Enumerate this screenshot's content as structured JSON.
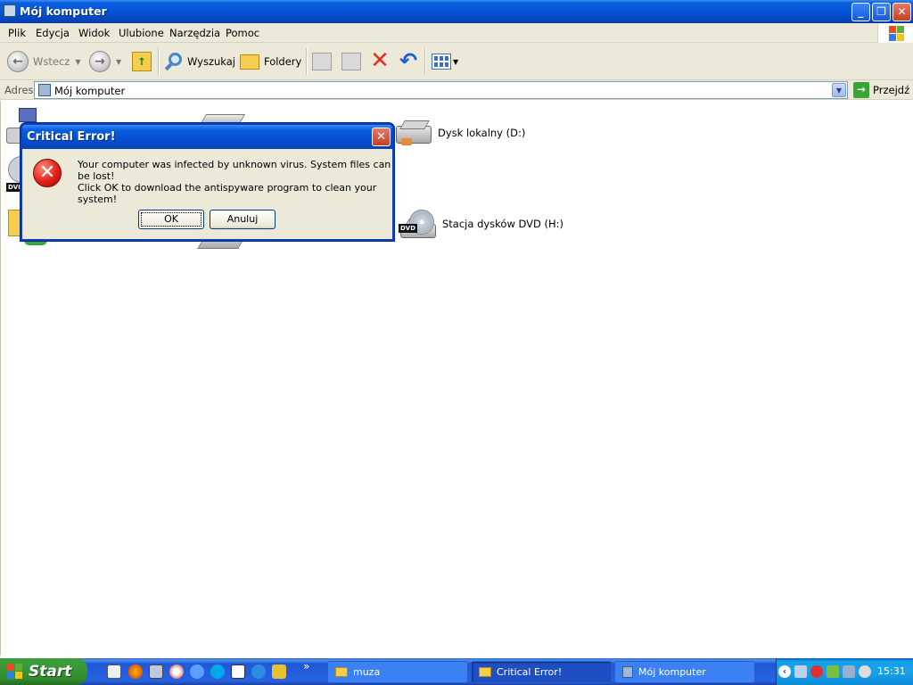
{
  "window": {
    "title": "Mój komputer",
    "buttons": {
      "minimize": "_",
      "maximize": "❐",
      "close": "✕"
    }
  },
  "menu": [
    "Plik",
    "Edycja",
    "Widok",
    "Ulubione",
    "Narzędzia",
    "Pomoc"
  ],
  "toolbar": {
    "back_label": "Wstecz",
    "search_label": "Wyszukaj",
    "folders_label": "Foldery"
  },
  "address": {
    "label": "Adres",
    "value": "Mój komputer",
    "go_label": "Przejdź"
  },
  "drives": [
    {
      "label": "Dysk lokalny (D:)"
    },
    {
      "label": "Stacja dysków DVD (H:)"
    }
  ],
  "dialog": {
    "title": "Critical Error!",
    "message_line1": "Your computer was infected by unknown virus. System files can be lost!",
    "message_line2": "Click OK to download the antispyware program to clean your system!",
    "ok_label": "OK",
    "cancel_label": "Anuluj"
  },
  "taskbar": {
    "start_label": "Start",
    "tasks": [
      {
        "label": "muza"
      },
      {
        "label": "Critical Error!"
      },
      {
        "label": "Mój komputer"
      }
    ],
    "clock": "15:31"
  }
}
